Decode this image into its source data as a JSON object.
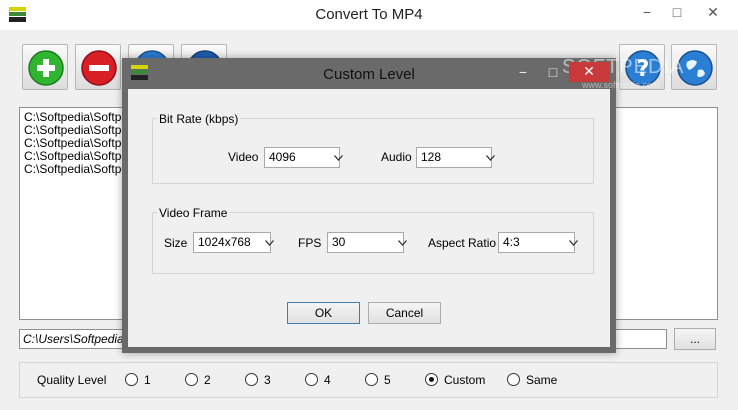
{
  "window": {
    "title": "Convert To MP4",
    "controls": {
      "minimize": "−",
      "maximize": "□",
      "close": "✕"
    }
  },
  "toolbar": {
    "buttons": [
      {
        "name": "add-button",
        "icon": "plus-icon",
        "color": "#2fb52f"
      },
      {
        "name": "remove-button",
        "icon": "minus-icon",
        "color": "#d81f26"
      },
      {
        "name": "convert-button",
        "icon": "globe-icon",
        "color": "#2a7fd4"
      },
      {
        "name": "stop-button",
        "icon": "globe-icon",
        "color": "#1f5fae"
      },
      {
        "name": "help-button",
        "icon": "help-icon",
        "color": "#2a7fd4"
      },
      {
        "name": "web-button",
        "icon": "globe-icon",
        "color": "#2a7fd4"
      }
    ]
  },
  "file_list": {
    "items": [
      "C:\\Softpedia\\Softpe",
      "C:\\Softpedia\\Softpe",
      "C:\\Softpedia\\Softpe",
      "C:\\Softpedia\\Softpe",
      "C:\\Softpedia\\Softpe"
    ]
  },
  "output": {
    "path": "C:\\Users\\Softpedia\\",
    "browse_label": "..."
  },
  "quality": {
    "label": "Quality Level",
    "options": [
      "1",
      "2",
      "3",
      "4",
      "5",
      "Custom",
      "Same"
    ],
    "selected": "Custom"
  },
  "dialog": {
    "title": "Custom Level",
    "watermark": "SOFTPEDIA",
    "watermark_sub": "www.softpedia.com",
    "bitrate": {
      "group_label": "Bit Rate (kbps)",
      "video_label": "Video",
      "video_value": "4096",
      "audio_label": "Audio",
      "audio_value": "128"
    },
    "frame": {
      "group_label": "Video Frame",
      "size_label": "Size",
      "size_value": "1024x768",
      "fps_label": "FPS",
      "fps_value": "30",
      "aspect_label": "Aspect Ratio",
      "aspect_value": "4:3"
    },
    "ok_label": "OK",
    "cancel_label": "Cancel"
  }
}
